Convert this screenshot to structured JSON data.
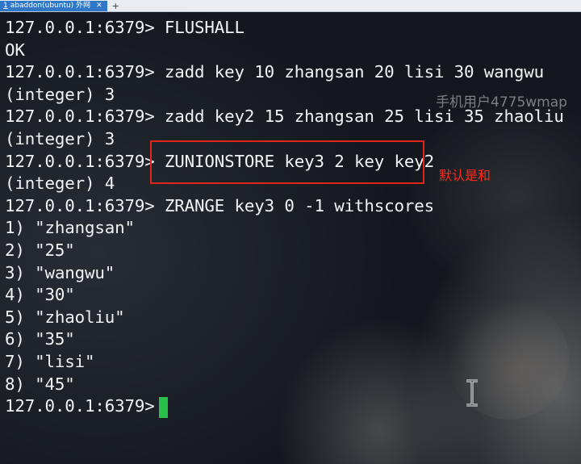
{
  "tab": {
    "number": "1",
    "title": "abaddon(ubuntu) 外网",
    "close_glyph": "✕",
    "add_glyph": "+"
  },
  "terminal": {
    "lines": [
      "127.0.0.1:6379> FLUSHALL",
      "OK",
      "127.0.0.1:6379> zadd key 10 zhangsan 20 lisi 30 wangwu",
      "(integer) 3",
      "127.0.0.1:6379> zadd key2 15 zhangsan 25 lisi 35 zhaoliu",
      "(integer) 3",
      "127.0.0.1:6379> ZUNIONSTORE key3 2 key key2",
      "(integer) 4",
      "127.0.0.1:6379> ZRANGE key3 0 -1 withscores",
      "1) \"zhangsan\"",
      "2) \"25\"",
      "3) \"wangwu\"",
      "4) \"30\"",
      "5) \"zhaoliu\"",
      "6) \"35\"",
      "7) \"lisi\"",
      "8) \"45\"",
      "127.0.0.1:6379> "
    ],
    "cursor_color": "#29c14c"
  },
  "annotation": {
    "text": "默认是和",
    "color": "#ff2a1a",
    "box_color": "#e0251b"
  },
  "watermark": {
    "text": "手机用户4775wmap"
  }
}
